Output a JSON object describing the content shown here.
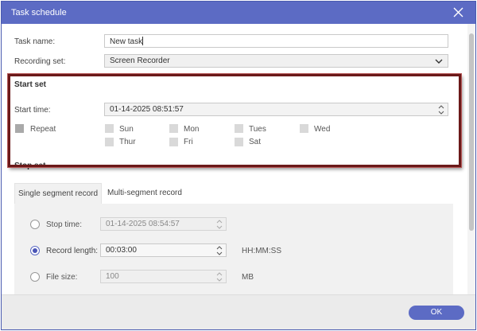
{
  "window": {
    "title": "Task schedule"
  },
  "task": {
    "name_label": "Task name:",
    "name_value": "New task"
  },
  "recording": {
    "label": "Recording set:",
    "value": "Screen Recorder"
  },
  "start_set": {
    "title": "Start set",
    "time_label": "Start time:",
    "time_value": "01-14-2025 08:51:57",
    "repeat_label": "Repeat",
    "days": [
      "Sun",
      "Mon",
      "Tues",
      "Wed",
      "Thur",
      "Fri",
      "Sat"
    ]
  },
  "stop_set": {
    "title": "Stop set"
  },
  "tabs": {
    "single": "Single segment record",
    "multi": "Multi-segment record"
  },
  "stop_options": {
    "stop_time_label": "Stop time:",
    "stop_time_value": "01-14-2025 08:54:57",
    "record_length_label": "Record length:",
    "record_length_value": "00:03:00",
    "record_length_unit": "HH:MM:SS",
    "file_size_label": "File size:",
    "file_size_value": "100",
    "file_size_unit": "MB"
  },
  "footer": {
    "ok_label": "OK"
  }
}
